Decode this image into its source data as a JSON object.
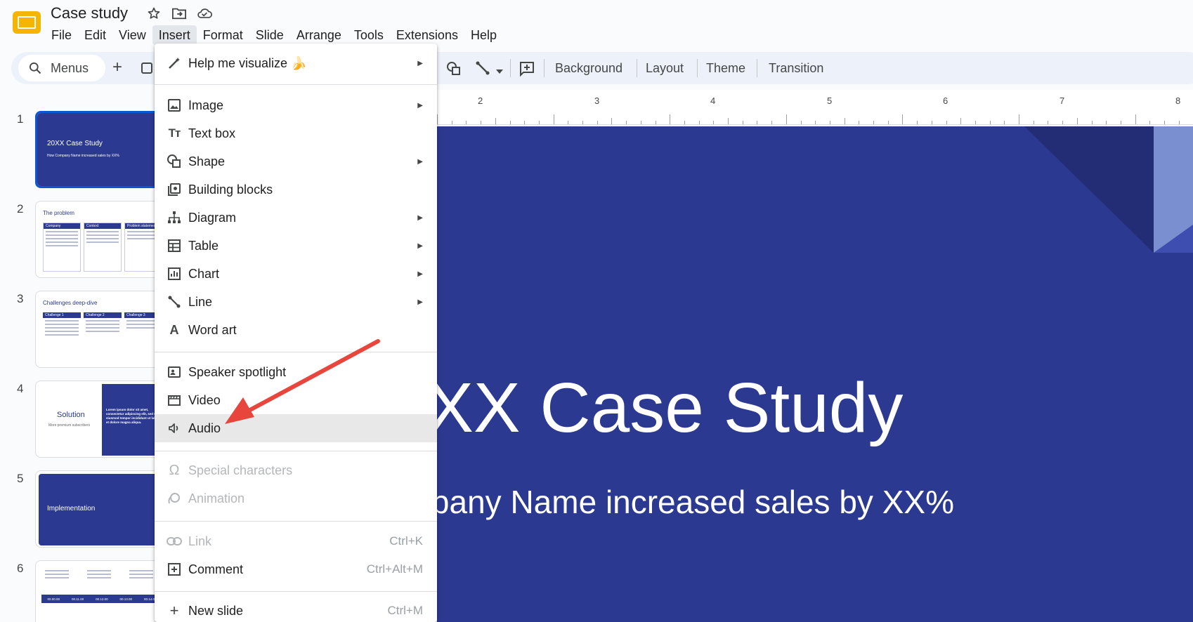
{
  "app": {
    "title": "Case study",
    "icons": [
      "star-icon",
      "move-to-folder-icon",
      "cloud-status-icon"
    ]
  },
  "menubar": [
    "File",
    "Edit",
    "View",
    "Insert",
    "Format",
    "Slide",
    "Arrange",
    "Tools",
    "Extensions",
    "Help"
  ],
  "toolbar": {
    "search_label": "Menus",
    "background": "Background",
    "layout": "Layout",
    "theme": "Theme",
    "transition": "Transition"
  },
  "ruler": [
    "2",
    "3",
    "4",
    "5",
    "6",
    "7",
    "8"
  ],
  "slide": {
    "title": "20XX Case Study",
    "subtitle": "How Company Name increased sales by XX%",
    "background_color": "#2b3990"
  },
  "filmstrip": {
    "numbers": [
      "1",
      "2",
      "3",
      "4",
      "5",
      "6"
    ],
    "slide1": {
      "title": "20XX Case Study",
      "sub": "How Company Name increased sales by XX%"
    },
    "slide2": {
      "title": "The problem",
      "cols": [
        "Company",
        "Context",
        "Problem statement"
      ]
    },
    "slide3": {
      "title": "Challenges deep-dive",
      "cols": [
        "Challenge 1",
        "Challenge 2",
        "Challenge 3"
      ]
    },
    "slide4": {
      "title": "Solution",
      "sub": "More premium subscribers",
      "body": "Lorem ipsum dolor sit amet, consectetur adipiscing elit, sed do eiusmod tempor incididunt ut labore et dolore magna aliqua."
    },
    "slide5": {
      "title": "Implementation"
    },
    "slide6": {
      "dates": [
        "00.00.00",
        "00.11.00",
        "00.12.00",
        "00.13.00",
        "00.14.00"
      ]
    }
  },
  "insert_menu": {
    "help_visualize": "Help me visualize 🍌",
    "image": "Image",
    "text_box": "Text box",
    "shape": "Shape",
    "building_blocks": "Building blocks",
    "diagram": "Diagram",
    "table": "Table",
    "chart": "Chart",
    "line": "Line",
    "word_art": "Word art",
    "speaker_spotlight": "Speaker spotlight",
    "video": "Video",
    "audio": "Audio",
    "special_characters": "Special characters",
    "animation": "Animation",
    "link": "Link",
    "link_shortcut": "Ctrl+K",
    "comment": "Comment",
    "comment_shortcut": "Ctrl+Alt+M",
    "new_slide": "New slide",
    "new_slide_shortcut": "Ctrl+M"
  },
  "colors": {
    "accent": "#0b57d0",
    "slide_blue": "#2b3990",
    "annotation_red": "#e8453c"
  }
}
